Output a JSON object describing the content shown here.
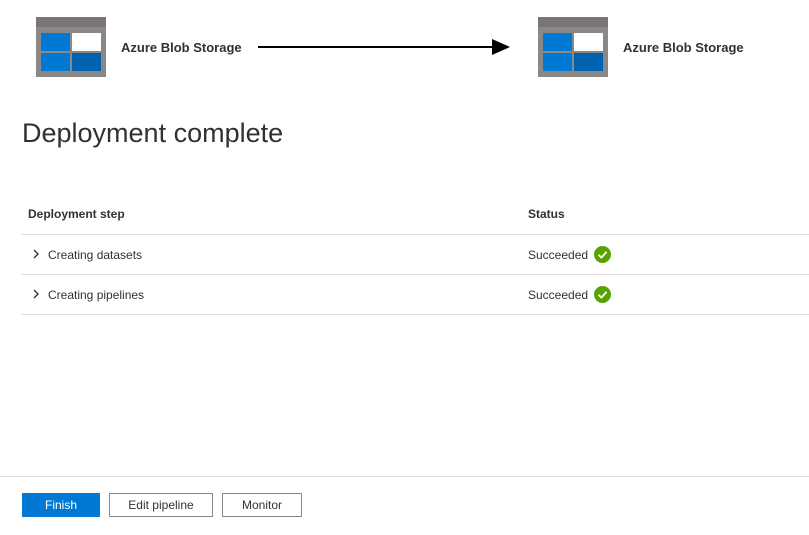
{
  "pipeline": {
    "source": {
      "label": "Azure Blob Storage",
      "icon": "blob-storage-icon"
    },
    "destination": {
      "label": "Azure Blob Storage",
      "icon": "blob-storage-icon"
    }
  },
  "title": "Deployment complete",
  "table": {
    "headers": {
      "step": "Deployment step",
      "status": "Status"
    },
    "rows": [
      {
        "step": "Creating datasets",
        "status": "Succeeded"
      },
      {
        "step": "Creating pipelines",
        "status": "Succeeded"
      }
    ]
  },
  "buttons": {
    "finish": "Finish",
    "edit_pipeline": "Edit pipeline",
    "monitor": "Monitor"
  },
  "colors": {
    "accent": "#0078d4",
    "success": "#57a300",
    "icon_gray": "#8a8886"
  }
}
